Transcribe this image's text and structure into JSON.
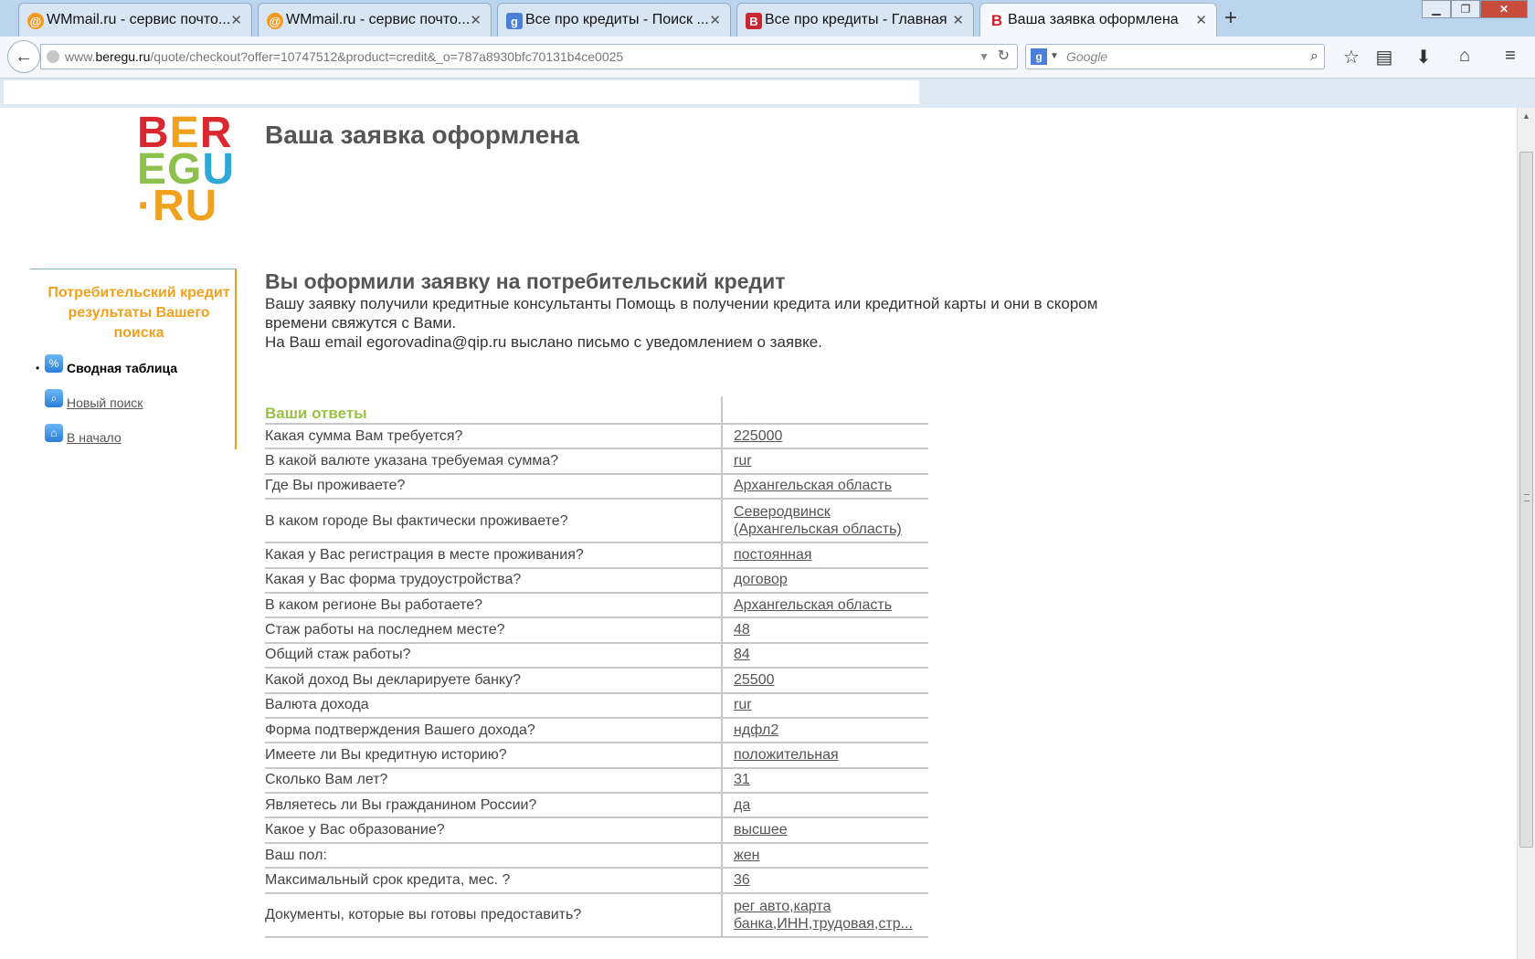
{
  "browser": {
    "tabs": [
      {
        "label": "WMmail.ru - сервис почто...",
        "icon": "wmmail-favicon",
        "active": false
      },
      {
        "label": "WMmail.ru - сервис почто...",
        "icon": "wmmail-favicon",
        "active": false
      },
      {
        "label": "Все про кредиты - Поиск ...",
        "icon": "google-favicon",
        "active": false
      },
      {
        "label": "Все про кредиты - Главная",
        "icon": "blogger-favicon",
        "active": false
      },
      {
        "label": "Ваша заявка оформлена",
        "icon": "beregu-favicon",
        "active": true
      }
    ],
    "url_prefix": "www.",
    "url_host": "beregu.ru",
    "url_path": "/quote/checkout?offer=10747512&product=credit&_o=787a8930bfc70131b4ce0025",
    "search_placeholder": "Google"
  },
  "logo": {
    "row1": [
      "B",
      "E",
      "R"
    ],
    "row2": [
      "E",
      "G",
      "U"
    ],
    "row3": "·RU"
  },
  "header": {
    "title": "Ваша заявка оформлена"
  },
  "sidebar": {
    "heading": "Потребительский кредит результаты Вашего поиска",
    "items": [
      {
        "label": "Сводная таблица",
        "icon": "percent-icon",
        "current": true
      },
      {
        "label": "Новый поиск",
        "icon": "search-icon",
        "current": false
      },
      {
        "label": "В начало",
        "icon": "home-icon",
        "current": false
      }
    ]
  },
  "content": {
    "subtitle": "Вы оформили заявку на потребительский кредит",
    "message1": "Вашу заявку получили кредитные консультанты Помощь в получении кредита или кредитной карты и они в скором времени свяжутся с Вами.",
    "message2": "На Ваш email egorovadina@qip.ru выслано письмо с уведомлением о заявке."
  },
  "answers": {
    "header": "Ваши ответы",
    "rows": [
      {
        "q": "Какая сумма Вам требуется?",
        "a": "225000"
      },
      {
        "q": "В какой валюте указана требуемая сумма?",
        "a": "rur"
      },
      {
        "q": "Где Вы проживаете?",
        "a": "Архангельская область"
      },
      {
        "q": "В каком городе Вы фактически проживаете?",
        "a": "Северодвинск (Архангельская область)"
      },
      {
        "q": "Какая у Вас регистрация в месте проживания?",
        "a": "постоянная"
      },
      {
        "q": "Какая у Вас форма трудоустройства?",
        "a": "договор"
      },
      {
        "q": "В каком регионе Вы работаете?",
        "a": "Архангельская область"
      },
      {
        "q": "Стаж работы на последнем месте?",
        "a": "48"
      },
      {
        "q": "Общий стаж работы?",
        "a": "84"
      },
      {
        "q": "Какой доход Вы декларируете банку?",
        "a": "25500"
      },
      {
        "q": "Валюта дохода",
        "a": "rur"
      },
      {
        "q": "Форма подтверждения Вашего дохода?",
        "a": "ндфл2"
      },
      {
        "q": "Имеете ли Вы кредитную историю?",
        "a": "положительная"
      },
      {
        "q": "Сколько Вам лет?",
        "a": "31"
      },
      {
        "q": "Являетесь ли Вы гражданином России?",
        "a": "да"
      },
      {
        "q": "Какое у Вас образование?",
        "a": "высшее"
      },
      {
        "q": "Ваш пол:",
        "a": "жен"
      },
      {
        "q": "Максимальный срок кредита, мес. ?",
        "a": "36"
      },
      {
        "q": "Документы, которые вы готовы предоставить?",
        "a": "рег авто,карта банка,ИНН,трудовая,стр..."
      }
    ]
  },
  "colors": {
    "accent_orange": "#f0a11e",
    "accent_green": "#9cc14a",
    "logo_red": "#d9282f"
  }
}
